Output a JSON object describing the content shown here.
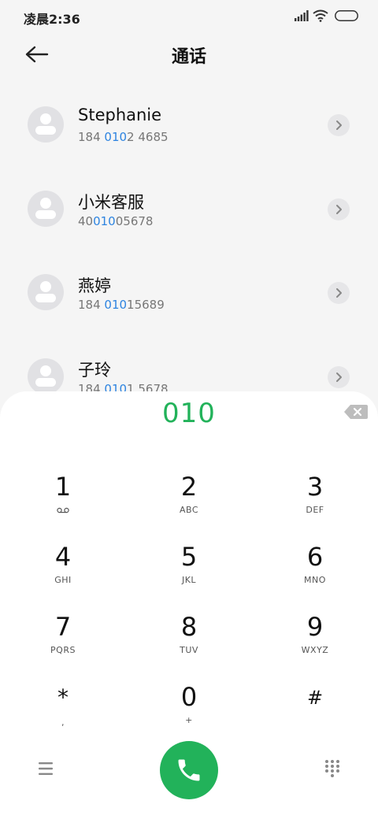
{
  "status_bar": {
    "time": "凌晨2:36"
  },
  "header": {
    "title": "通话"
  },
  "contacts": [
    {
      "name": "Stephanie",
      "number_parts": [
        "184 ",
        "010",
        "2 4685"
      ]
    },
    {
      "name": "小米客服",
      "number_parts": [
        "40",
        "010",
        "05678"
      ]
    },
    {
      "name": "燕婷",
      "number_parts": [
        "184 ",
        "010",
        "15689"
      ]
    },
    {
      "name": "子玲",
      "number_parts": [
        "184 ",
        "010",
        "1 5678"
      ]
    }
  ],
  "dialpad": {
    "input": "010",
    "keys": [
      {
        "digit": "1",
        "letters": "",
        "sub_icon": "voicemail-icon"
      },
      {
        "digit": "2",
        "letters": "ABC"
      },
      {
        "digit": "3",
        "letters": "DEF"
      },
      {
        "digit": "4",
        "letters": "GHI"
      },
      {
        "digit": "5",
        "letters": "JKL"
      },
      {
        "digit": "6",
        "letters": "MNO"
      },
      {
        "digit": "7",
        "letters": "PQRS"
      },
      {
        "digit": "8",
        "letters": "TUV"
      },
      {
        "digit": "9",
        "letters": "WXYZ"
      },
      {
        "digit": "*",
        "letters": ","
      },
      {
        "digit": "0",
        "letters": "+"
      },
      {
        "digit": "#",
        "letters": ""
      }
    ]
  },
  "colors": {
    "accent_green": "#22b25a",
    "match_blue": "#2e84e0"
  },
  "icons": {
    "back": "arrow-left-icon",
    "backspace": "backspace-icon",
    "call": "phone-icon",
    "menu": "hamburger-menu-icon",
    "keypad": "keypad-grid-icon",
    "chevron": "chevron-right-icon"
  }
}
